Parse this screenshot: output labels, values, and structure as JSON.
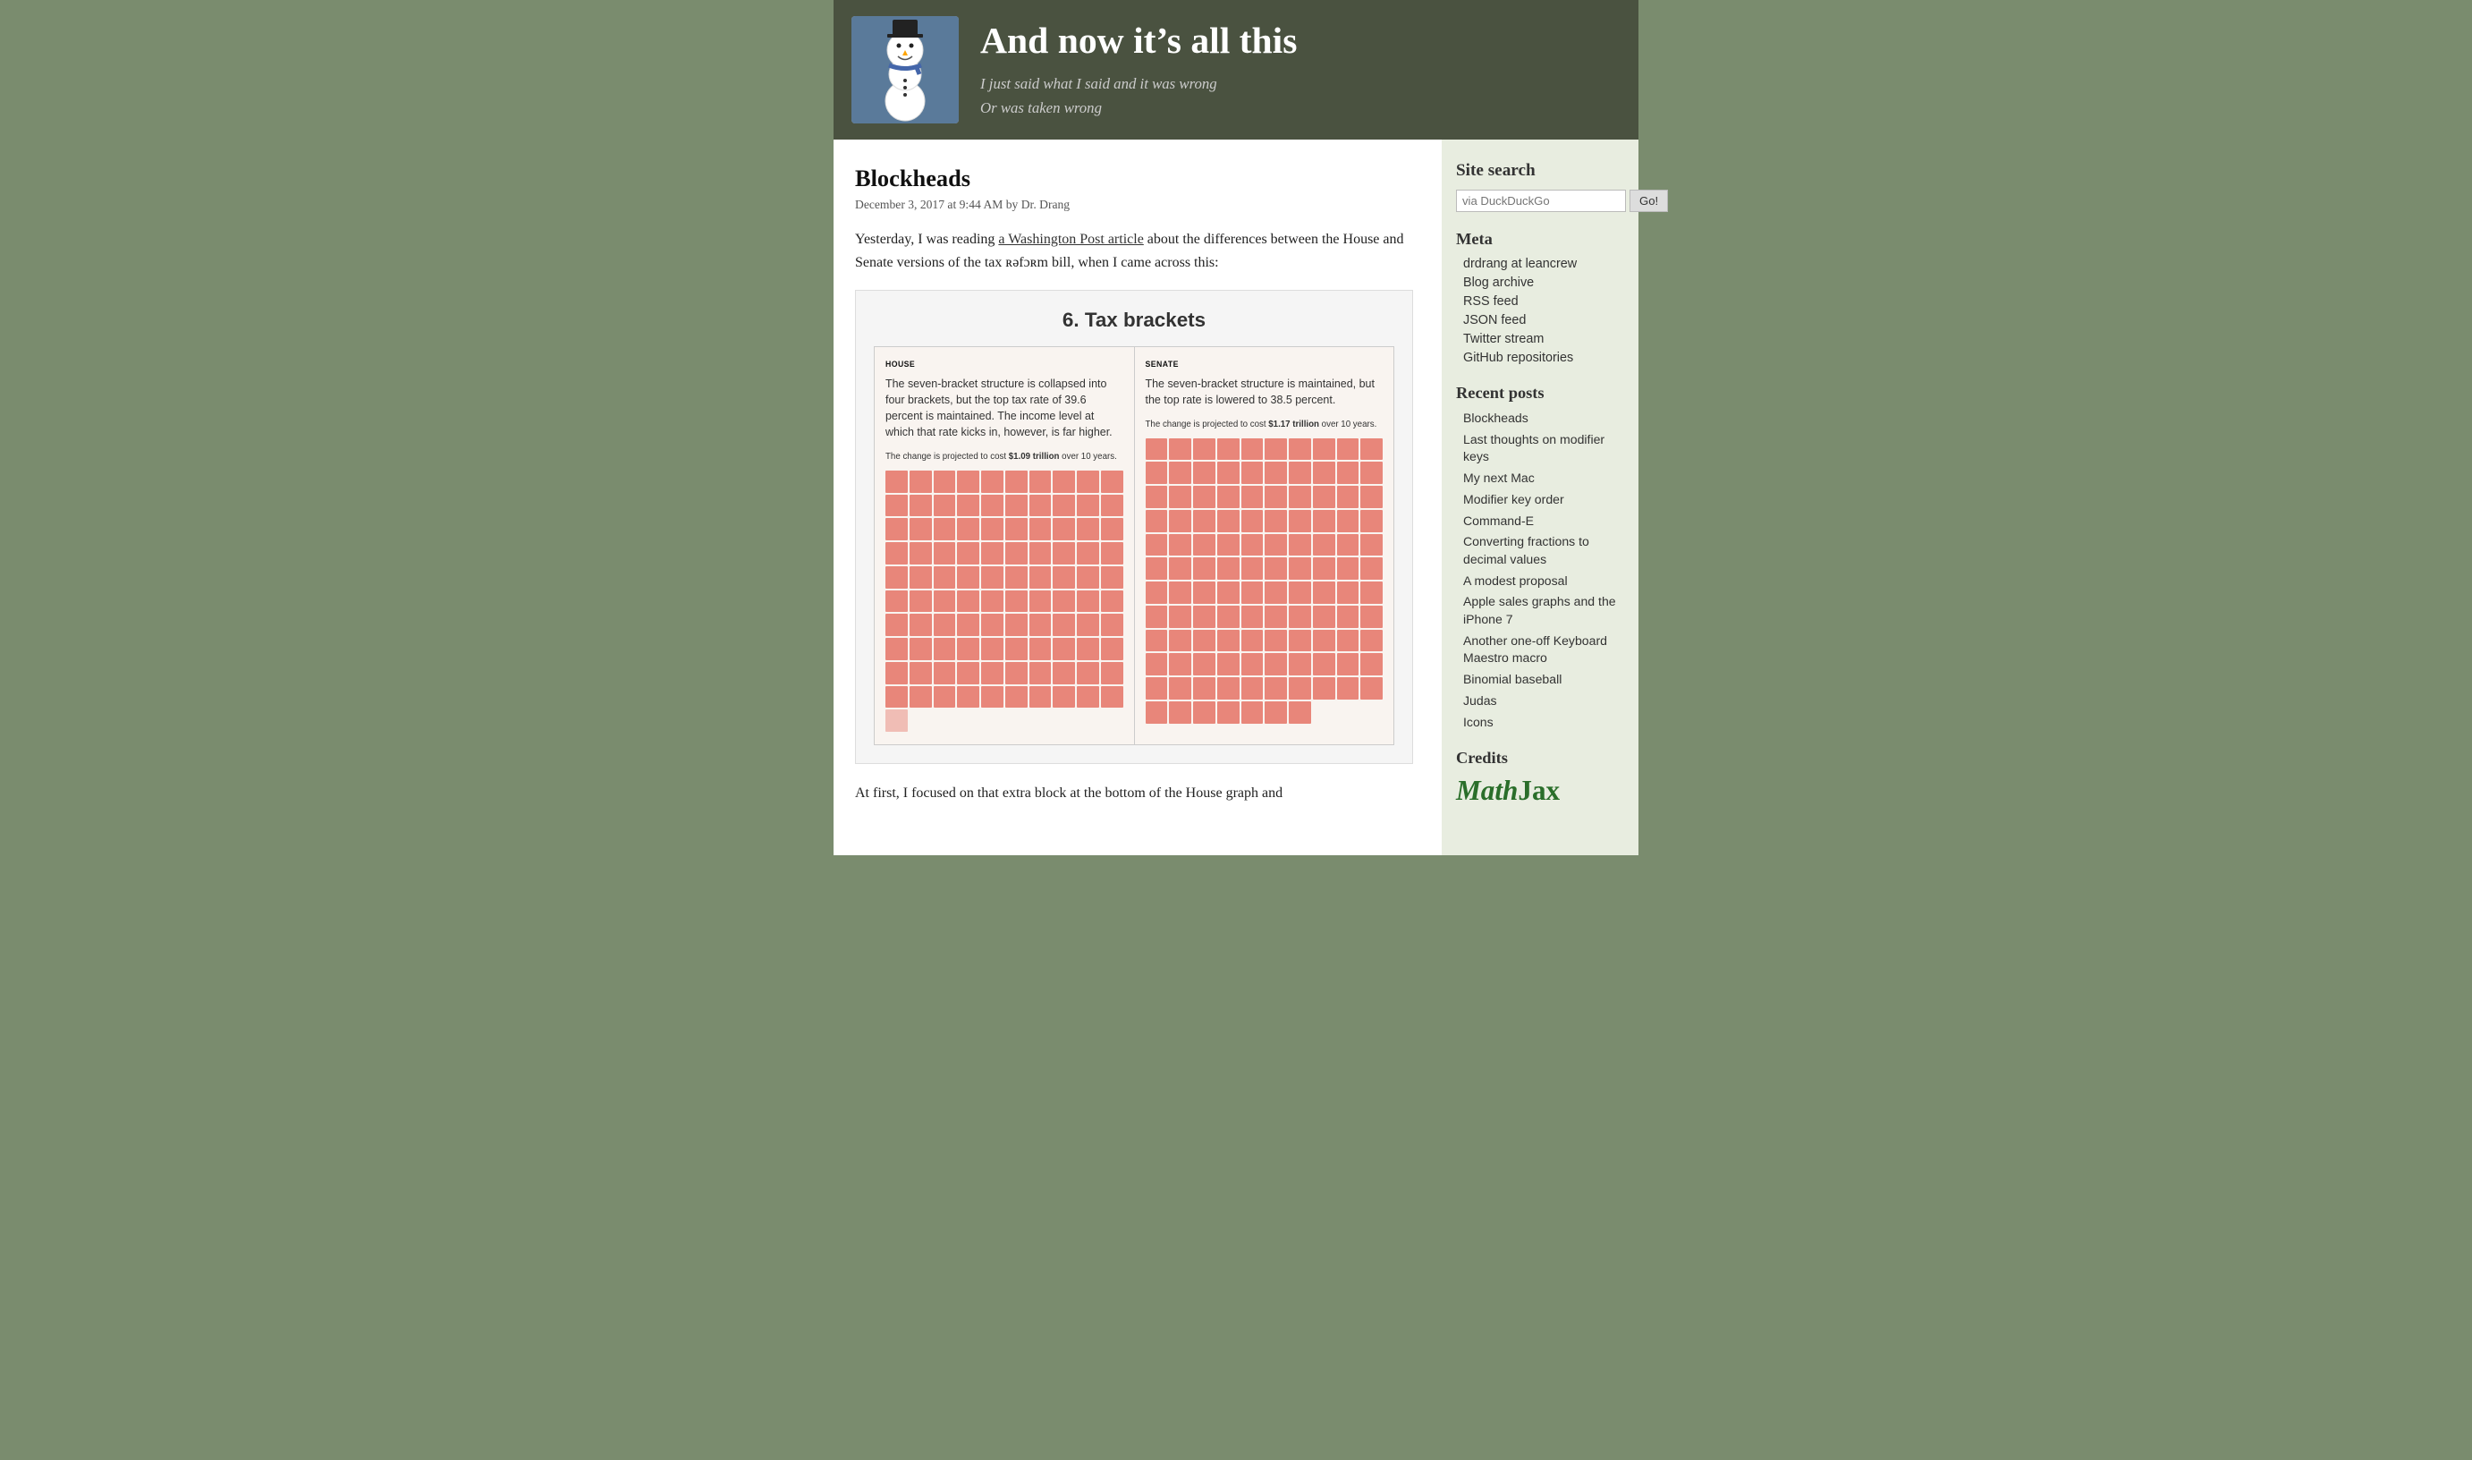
{
  "header": {
    "site_title": "And now it’s all this",
    "tagline_line1": "I just said what I said and it was wrong",
    "tagline_line2": "Or was taken wrong",
    "avatar_emoji": "☃"
  },
  "post": {
    "title": "Blockheads",
    "meta": "December 3, 2017 at 9:44 AM by Dr. Drang",
    "body_p1_prefix": "Yesterday, I was reading ",
    "body_p1_link": "a Washington Post article",
    "body_p1_suffix": " about the differences between the House and Senate versions of the tax ʀəfɔʀm bill, when I came across this:",
    "body_p2": "At first, I focused on that extra block at the bottom of the House graph and",
    "tax_chart_title": "6. Tax brackets",
    "house_label": "HOUSE",
    "house_desc": "The seven-bracket structure is collapsed into four brackets, but the top tax rate of 39.6 percent is maintained. The income level at which that rate kicks in, however, is far higher.",
    "house_cost": "The change is projected to cost ",
    "house_cost_bold": "$1.09 trillion",
    "house_cost_suffix": " over 10 years.",
    "senate_label": "SENATE",
    "senate_desc": "The seven-bracket structure is maintained, but the top rate is lowered to 38.5 percent.",
    "senate_cost": "The change is projected to cost ",
    "senate_cost_bold": "$1.17 trillion",
    "senate_cost_suffix": " over 10 years."
  },
  "sidebar": {
    "search_title": "Site search",
    "search_placeholder": "via DuckDuckGo",
    "search_button": "Go!",
    "meta_title": "Meta",
    "meta_links": [
      "drdrang at leancrew",
      "Blog archive",
      "RSS feed",
      "JSON feed",
      "Twitter stream",
      "GitHub repositories"
    ],
    "recent_posts_title": "Recent posts",
    "recent_posts": [
      "Blockheads",
      "Last thoughts on modifier keys",
      "My next Mac",
      "Modifier key order",
      "Command-E",
      "Converting fractions to decimal values",
      "A modest proposal",
      "Apple sales graphs and the iPhone 7",
      "Another one-off Keyboard Maestro macro",
      "Binomial baseball",
      "Judas",
      "Icons"
    ],
    "credits_title": "Credits",
    "credits_logo": "MathJax"
  }
}
